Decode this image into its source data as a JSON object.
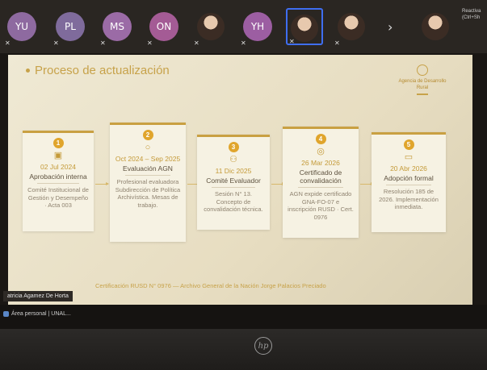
{
  "participants": [
    {
      "initials": "YU",
      "color": "#8e6aa0"
    },
    {
      "initials": "PL",
      "color": "#7f6b9c"
    },
    {
      "initials": "MS",
      "color": "#9b6ba6"
    },
    {
      "initials": "ON",
      "color": "#a45b95"
    },
    {
      "initials": "",
      "color": "#3b2c24"
    },
    {
      "initials": "YH",
      "color": "#9c5ea2"
    },
    {
      "initials": "",
      "color": "#3b2c24"
    },
    {
      "initials": "",
      "color": "#3b2c24"
    },
    {
      "initials": "",
      "color": "#3b2c24"
    }
  ],
  "corner_text": "Reactiva (Ctrl+Sh",
  "slide": {
    "title": "Proceso de actualización",
    "logo_text": "Agencia de Desarrollo Rural",
    "steps": [
      {
        "num": "1",
        "icon": "calendar-icon",
        "date": "02 Jul 2024",
        "title": "Aprobación interna",
        "desc": "Comité Institucional de Gestión y Desempeño · Acta 003"
      },
      {
        "num": "2",
        "icon": "search-icon",
        "date": "Oct 2024 – Sep 2025",
        "title": "Evaluación AGN",
        "desc": "Profesional evaluadora Subdirección de Política Archivística. Mesas de trabajo."
      },
      {
        "num": "3",
        "icon": "users-icon",
        "date": "11 Dic 2025",
        "title": "Comité Evaluador",
        "desc": "Sesión N° 13. Concepto de convalidación técnica."
      },
      {
        "num": "4",
        "icon": "award-icon",
        "date": "26 Mar 2026",
        "title": "Certificado de convalidación",
        "desc": "AGN expide certificado GNA-FO-07 e inscripción RUSD · Cert. 0976"
      },
      {
        "num": "5",
        "icon": "document-icon",
        "date": "20 Abr 2026",
        "title": "Adopción formal",
        "desc": "Resolución 185 de 2026. Implementación inmediata."
      }
    ],
    "footer": "Certificación RUSD N° 0976 — Archivo General de la Nación Jorge Palacios Preciado"
  },
  "name_tag": "atricia Agamez De Horta",
  "taskbar": {
    "item": "Área personal | UNAL..."
  },
  "brand": "hp"
}
